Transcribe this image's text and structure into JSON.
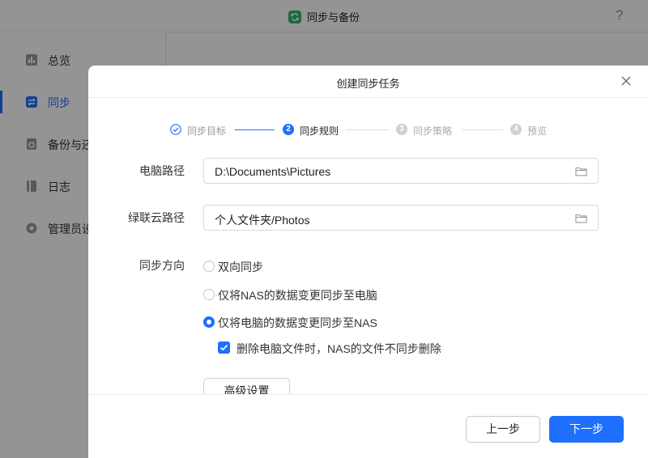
{
  "window": {
    "title": "同步与备份",
    "help_icon": "?"
  },
  "sidebar": {
    "items": [
      {
        "label": "总览",
        "icon": "chart-icon"
      },
      {
        "label": "同步",
        "icon": "sync-icon",
        "active": true
      },
      {
        "label": "备份与还原",
        "icon": "backup-icon"
      },
      {
        "label": "日志",
        "icon": "log-icon"
      },
      {
        "label": "管理员设置",
        "icon": "gear-icon"
      }
    ]
  },
  "dialog": {
    "title": "创建同步任务",
    "steps": [
      {
        "num": "✓",
        "label": "同步目标",
        "state": "done"
      },
      {
        "num": "2",
        "label": "同步规则",
        "state": "current"
      },
      {
        "num": "3",
        "label": "同步策略",
        "state": "pending"
      },
      {
        "num": "4",
        "label": "预览",
        "state": "pending"
      }
    ],
    "pc_path": {
      "label": "电脑路径",
      "value": "D:\\Documents\\Pictures"
    },
    "cloud_path": {
      "label": "绿联云路径",
      "value": "个人文件夹/Photos"
    },
    "direction": {
      "label": "同步方向",
      "options": [
        {
          "label": "双向同步",
          "checked": false
        },
        {
          "label": "仅将NAS的数据变更同步至电脑",
          "checked": false
        },
        {
          "label": "仅将电脑的数据变更同步至NAS",
          "checked": true
        }
      ],
      "no_delete": {
        "label": "删除电脑文件时，NAS的文件不同步删除",
        "checked": true
      }
    },
    "advanced_label": "高级设置",
    "prev_label": "上一步",
    "next_label": "下一步"
  },
  "colors": {
    "accent": "#1f6fff",
    "logo": "#2fb56a"
  }
}
